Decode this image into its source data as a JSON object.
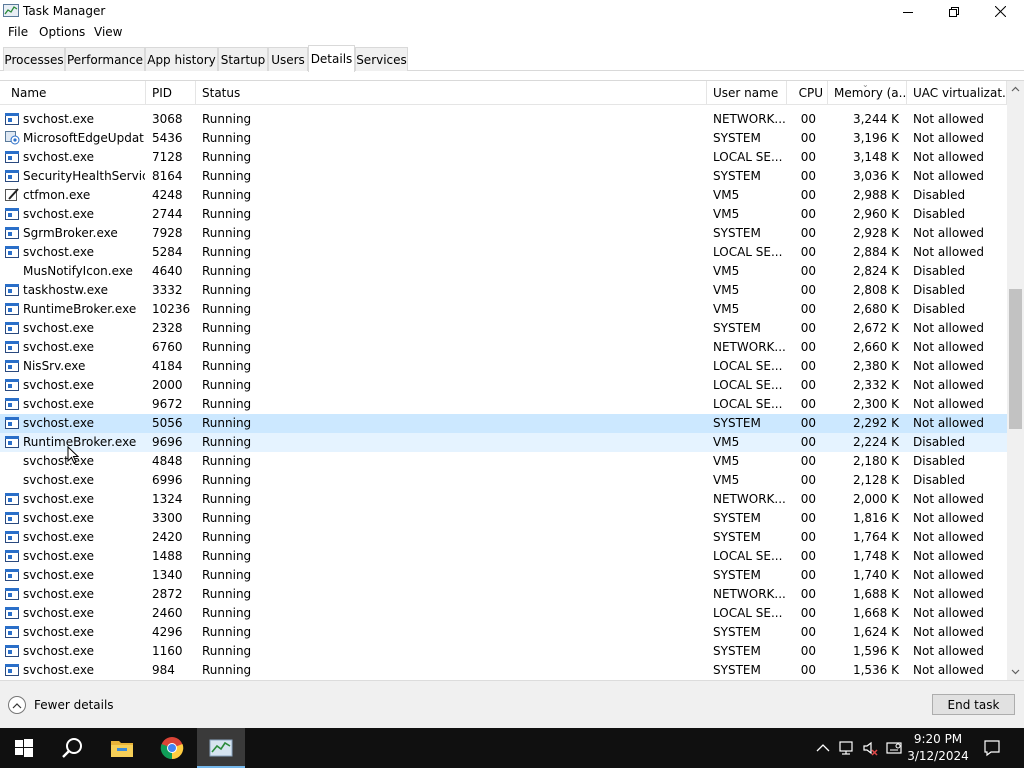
{
  "window": {
    "title": "Task Manager"
  },
  "menu": [
    "File",
    "Options",
    "View"
  ],
  "tabs": [
    {
      "label": "Processes",
      "active": false
    },
    {
      "label": "Performance",
      "active": false
    },
    {
      "label": "App history",
      "active": false
    },
    {
      "label": "Startup",
      "active": false
    },
    {
      "label": "Users",
      "active": false
    },
    {
      "label": "Details",
      "active": true
    },
    {
      "label": "Services",
      "active": false
    }
  ],
  "columns": {
    "name": "Name",
    "pid": "PID",
    "status": "Status",
    "user": "User name",
    "cpu": "CPU",
    "memory": "Memory (a...",
    "uac": "UAC virtualizat..."
  },
  "rows": [
    {
      "name": "svchost.exe",
      "pid": "3068",
      "status": "Running",
      "user": "NETWORK...",
      "cpu": "00",
      "memory": "3,244 K",
      "uac": "Not allowed",
      "icon": "service-window-icon"
    },
    {
      "name": "MicrosoftEdgeUpdat...",
      "pid": "5436",
      "status": "Running",
      "user": "SYSTEM",
      "cpu": "00",
      "memory": "3,196 K",
      "uac": "Not allowed",
      "icon": "edge-update-icon"
    },
    {
      "name": "svchost.exe",
      "pid": "7128",
      "status": "Running",
      "user": "LOCAL SE...",
      "cpu": "00",
      "memory": "3,148 K",
      "uac": "Not allowed",
      "icon": "service-window-icon"
    },
    {
      "name": "SecurityHealthServic...",
      "pid": "8164",
      "status": "Running",
      "user": "SYSTEM",
      "cpu": "00",
      "memory": "3,036 K",
      "uac": "Not allowed",
      "icon": "service-window-icon"
    },
    {
      "name": "ctfmon.exe",
      "pid": "4248",
      "status": "Running",
      "user": "VM5",
      "cpu": "00",
      "memory": "2,988 K",
      "uac": "Disabled",
      "icon": "ctfmon-pen-icon"
    },
    {
      "name": "svchost.exe",
      "pid": "2744",
      "status": "Running",
      "user": "VM5",
      "cpu": "00",
      "memory": "2,960 K",
      "uac": "Disabled",
      "icon": "service-window-icon"
    },
    {
      "name": "SgrmBroker.exe",
      "pid": "7928",
      "status": "Running",
      "user": "SYSTEM",
      "cpu": "00",
      "memory": "2,928 K",
      "uac": "Not allowed",
      "icon": "service-window-icon"
    },
    {
      "name": "svchost.exe",
      "pid": "5284",
      "status": "Running",
      "user": "LOCAL SE...",
      "cpu": "00",
      "memory": "2,884 K",
      "uac": "Not allowed",
      "icon": "service-window-icon"
    },
    {
      "name": "MusNotifyIcon.exe",
      "pid": "4640",
      "status": "Running",
      "user": "VM5",
      "cpu": "00",
      "memory": "2,824 K",
      "uac": "Disabled",
      "icon": ""
    },
    {
      "name": "taskhostw.exe",
      "pid": "3332",
      "status": "Running",
      "user": "VM5",
      "cpu": "00",
      "memory": "2,808 K",
      "uac": "Disabled",
      "icon": "service-window-icon"
    },
    {
      "name": "RuntimeBroker.exe",
      "pid": "10236",
      "status": "Running",
      "user": "VM5",
      "cpu": "00",
      "memory": "2,680 K",
      "uac": "Disabled",
      "icon": "service-window-icon"
    },
    {
      "name": "svchost.exe",
      "pid": "2328",
      "status": "Running",
      "user": "SYSTEM",
      "cpu": "00",
      "memory": "2,672 K",
      "uac": "Not allowed",
      "icon": "service-window-icon"
    },
    {
      "name": "svchost.exe",
      "pid": "6760",
      "status": "Running",
      "user": "NETWORK...",
      "cpu": "00",
      "memory": "2,660 K",
      "uac": "Not allowed",
      "icon": "service-window-icon"
    },
    {
      "name": "NisSrv.exe",
      "pid": "4184",
      "status": "Running",
      "user": "LOCAL SE...",
      "cpu": "00",
      "memory": "2,380 K",
      "uac": "Not allowed",
      "icon": "service-window-icon"
    },
    {
      "name": "svchost.exe",
      "pid": "2000",
      "status": "Running",
      "user": "LOCAL SE...",
      "cpu": "00",
      "memory": "2,332 K",
      "uac": "Not allowed",
      "icon": "service-window-icon"
    },
    {
      "name": "svchost.exe",
      "pid": "9672",
      "status": "Running",
      "user": "LOCAL SE...",
      "cpu": "00",
      "memory": "2,300 K",
      "uac": "Not allowed",
      "icon": "service-window-icon"
    },
    {
      "name": "svchost.exe",
      "pid": "5056",
      "status": "Running",
      "user": "SYSTEM",
      "cpu": "00",
      "memory": "2,292 K",
      "uac": "Not allowed",
      "icon": "service-window-icon",
      "state": "selected"
    },
    {
      "name": "RuntimeBroker.exe",
      "pid": "9696",
      "status": "Running",
      "user": "VM5",
      "cpu": "00",
      "memory": "2,224 K",
      "uac": "Disabled",
      "icon": "service-window-icon",
      "state": "hovered"
    },
    {
      "name": "svchost.exe",
      "pid": "4848",
      "status": "Running",
      "user": "VM5",
      "cpu": "00",
      "memory": "2,180 K",
      "uac": "Disabled",
      "icon": ""
    },
    {
      "name": "svchost.exe",
      "pid": "6996",
      "status": "Running",
      "user": "VM5",
      "cpu": "00",
      "memory": "2,128 K",
      "uac": "Disabled",
      "icon": ""
    },
    {
      "name": "svchost.exe",
      "pid": "1324",
      "status": "Running",
      "user": "NETWORK...",
      "cpu": "00",
      "memory": "2,000 K",
      "uac": "Not allowed",
      "icon": "service-window-icon"
    },
    {
      "name": "svchost.exe",
      "pid": "3300",
      "status": "Running",
      "user": "SYSTEM",
      "cpu": "00",
      "memory": "1,816 K",
      "uac": "Not allowed",
      "icon": "service-window-icon"
    },
    {
      "name": "svchost.exe",
      "pid": "2420",
      "status": "Running",
      "user": "SYSTEM",
      "cpu": "00",
      "memory": "1,764 K",
      "uac": "Not allowed",
      "icon": "service-window-icon"
    },
    {
      "name": "svchost.exe",
      "pid": "1488",
      "status": "Running",
      "user": "LOCAL SE...",
      "cpu": "00",
      "memory": "1,748 K",
      "uac": "Not allowed",
      "icon": "service-window-icon"
    },
    {
      "name": "svchost.exe",
      "pid": "1340",
      "status": "Running",
      "user": "SYSTEM",
      "cpu": "00",
      "memory": "1,740 K",
      "uac": "Not allowed",
      "icon": "service-window-icon"
    },
    {
      "name": "svchost.exe",
      "pid": "2872",
      "status": "Running",
      "user": "NETWORK...",
      "cpu": "00",
      "memory": "1,688 K",
      "uac": "Not allowed",
      "icon": "service-window-icon"
    },
    {
      "name": "svchost.exe",
      "pid": "2460",
      "status": "Running",
      "user": "LOCAL SE...",
      "cpu": "00",
      "memory": "1,668 K",
      "uac": "Not allowed",
      "icon": "service-window-icon"
    },
    {
      "name": "svchost.exe",
      "pid": "4296",
      "status": "Running",
      "user": "SYSTEM",
      "cpu": "00",
      "memory": "1,624 K",
      "uac": "Not allowed",
      "icon": "service-window-icon"
    },
    {
      "name": "svchost.exe",
      "pid": "1160",
      "status": "Running",
      "user": "SYSTEM",
      "cpu": "00",
      "memory": "1,596 K",
      "uac": "Not allowed",
      "icon": "service-window-icon"
    },
    {
      "name": "svchost.exe",
      "pid": "984",
      "status": "Running",
      "user": "SYSTEM",
      "cpu": "00",
      "memory": "1,536 K",
      "uac": "Not allowed",
      "icon": "service-window-icon"
    }
  ],
  "footer": {
    "fewer_details": "Fewer details",
    "end_task": "End task"
  },
  "taskbar": {
    "apps": [
      "start-windows-icon",
      "search-icon",
      "file-explorer-icon",
      "chrome-icon",
      "task-manager-icon"
    ],
    "tray": [
      "chevron-up-icon",
      "network-icon",
      "volume-muted-icon",
      "keyboard-icon",
      "notification-icon"
    ],
    "time": "9:20 PM",
    "date": "3/12/2024"
  },
  "colors": {
    "selected_row": "#cce8ff",
    "hovered_row": "#e5f3ff",
    "taskbar": "#101010",
    "taskbar_accent": "#76b9ed"
  }
}
